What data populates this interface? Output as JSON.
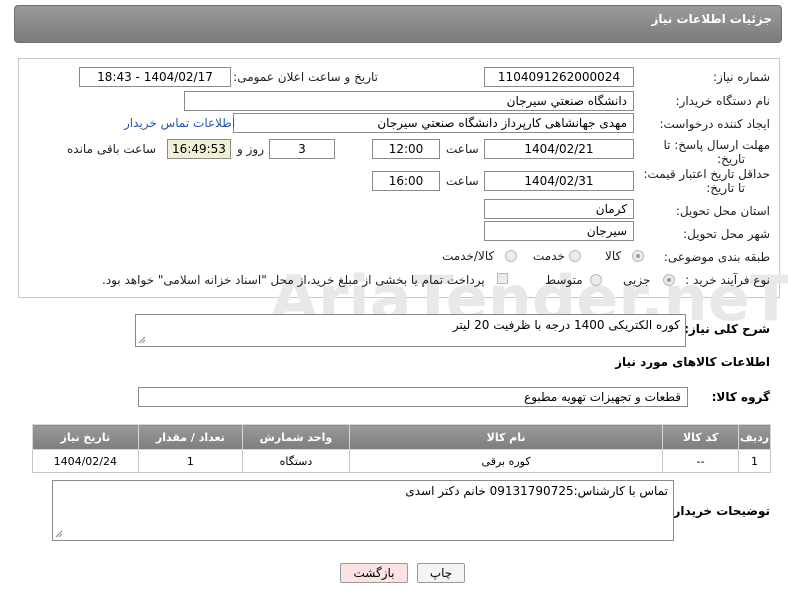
{
  "header": {
    "title": "جزئیات اطلاعات نیاز"
  },
  "watermark": {
    "text": "AriaTender.neT"
  },
  "form": {
    "need_number_label": "شماره نیاز:",
    "need_number_value": "1104091262000024",
    "announce_label": "تاریخ و ساعت اعلان عمومی:",
    "announce_value": "1404/02/17 - 18:43",
    "buyer_org_label": "نام دستگاه خریدار:",
    "buyer_org_value": "دانشگاه صنعتي سيرجان",
    "creator_label": "ایجاد کننده درخواست:",
    "creator_value": "مهدی جهانشاهی کارپرداز دانشگاه صنعتي سيرجان",
    "buyer_contact_link": "اطلاعات تماس خریدار",
    "deadline_label_1": "مهلت ارسال پاسخ: تا",
    "deadline_label_2": "تاریخ:",
    "deadline_date": "1404/02/21",
    "time_label": "ساعت",
    "deadline_time": "12:00",
    "days_value": "3",
    "days_label": "روز و",
    "remaining_time": "16:49:53",
    "remaining_label": "ساعت باقی مانده",
    "min_validity_label_1": "حداقل تاریخ اعتبار قیمت:",
    "min_validity_label_2": "تا تاریخ:",
    "validity_date": "1404/02/31",
    "validity_time_label": "ساعت",
    "validity_time": "16:00",
    "province_label": "استان محل تحویل:",
    "province_value": "كرمان",
    "city_label": "شهر محل تحویل:",
    "city_value": "سیرجان",
    "category_label": "طبقه بندی موضوعی:",
    "category_options": [
      "کالا",
      "خدمت",
      "کالا/خدمت"
    ],
    "category_selected": "کالا",
    "process_label": "نوع فرآیند خرید :",
    "process_options": [
      "جزیی",
      "متوسط"
    ],
    "process_selected": "جزیی",
    "payment_note": "پرداخت تمام یا بخشی از مبلغ خرید،از محل \"اسناد خزانه اسلامی\" خواهد بود."
  },
  "summary": {
    "label": "شرح کلی نیاز:",
    "value": "کوره الکتریکی 1400 درجه با ظرفیت 20 لیتر"
  },
  "goods_section": {
    "title": "اطلاعات کالاهای مورد نیاز",
    "group_label": "گروه کالا:",
    "group_value": "قطعات و تجهیزات تهویه مطبوع"
  },
  "table": {
    "headers": [
      "ردیف",
      "کد کالا",
      "نام کالا",
      "واحد شمارش",
      "تعداد / مقدار",
      "تاریخ نیاز"
    ],
    "rows": [
      [
        "1",
        "--",
        "کوره برقی",
        "دستگاه",
        "1",
        "1404/02/24"
      ]
    ]
  },
  "buyer_notes": {
    "label": "توضیحات خریدار:",
    "value": "تماس با کارشناس:09131790725 خانم دکتر اسدی"
  },
  "buttons": {
    "print": "چاپ",
    "back": "بازگشت"
  },
  "colors": {
    "header_bg": "#8a8a8a",
    "link": "#2a56a8",
    "time_box": "#f1efd3",
    "back_button": "#fbe3e3"
  }
}
